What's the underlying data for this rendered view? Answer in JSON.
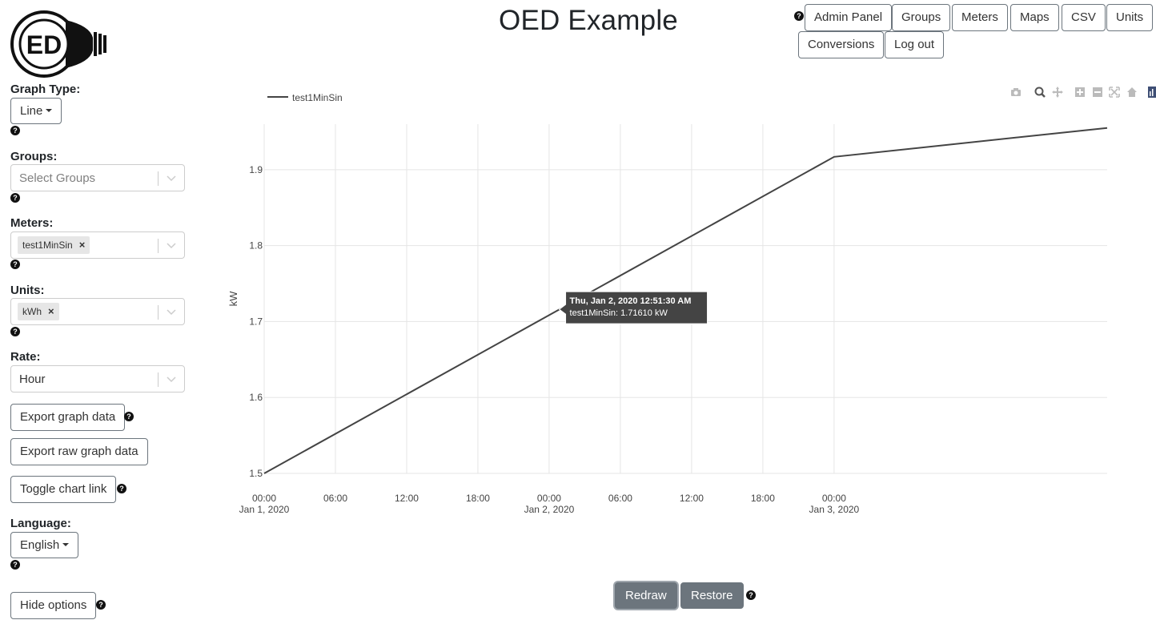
{
  "header": {
    "title": "OED Example",
    "logo_text": "ED"
  },
  "nav": {
    "buttons": [
      "Admin Panel",
      "Groups",
      "Meters",
      "Maps",
      "CSV",
      "Units",
      "Conversions",
      "Log out"
    ]
  },
  "sidebar": {
    "graph_type_label": "Graph Type:",
    "graph_type_value": "Line",
    "groups_label": "Groups:",
    "groups_placeholder": "Select Groups",
    "meters_label": "Meters:",
    "meters_selected": "test1MinSin",
    "units_label": "Units:",
    "units_selected": "kWh",
    "rate_label": "Rate:",
    "rate_value": "Hour",
    "export_graph": "Export graph data",
    "export_raw": "Export raw graph data",
    "toggle_link": "Toggle chart link",
    "language_label": "Language:",
    "language_value": "English",
    "hide_options": "Hide options",
    "chip_remove": "×"
  },
  "chart_data": {
    "type": "line",
    "series": [
      {
        "name": "test1MinSin",
        "x": [
          "2020-01-01 00:00",
          "2020-01-03 00:00",
          "2020-01-03 23:00"
        ],
        "y": [
          1.5,
          1.917,
          1.955
        ],
        "color": "#444444"
      }
    ],
    "ylabel": "kW",
    "xlabel": "",
    "ylim": [
      1.5,
      1.96
    ],
    "yticks": [
      "1.5",
      "1.6",
      "1.7",
      "1.8",
      "1.9"
    ],
    "xticks": [
      {
        "time": "00:00",
        "date": "Jan 1, 2020"
      },
      {
        "time": "06:00",
        "date": ""
      },
      {
        "time": "12:00",
        "date": ""
      },
      {
        "time": "18:00",
        "date": ""
      },
      {
        "time": "00:00",
        "date": "Jan 2, 2020"
      },
      {
        "time": "06:00",
        "date": ""
      },
      {
        "time": "12:00",
        "date": ""
      },
      {
        "time": "18:00",
        "date": ""
      },
      {
        "time": "00:00",
        "date": "Jan 3, 2020"
      }
    ],
    "legend_position": "top-left",
    "grid": true,
    "tooltip": {
      "title": "Thu, Jan 2, 2020 12:51:30 AM",
      "text": "test1MinSin: 1.71610 kW"
    }
  },
  "controls": {
    "redraw": "Redraw",
    "restore": "Restore"
  },
  "colors": {
    "line": "#444444",
    "grid": "#e5e5e5",
    "tooltip_bg": "#444444",
    "button_dark": "#6c757d"
  }
}
